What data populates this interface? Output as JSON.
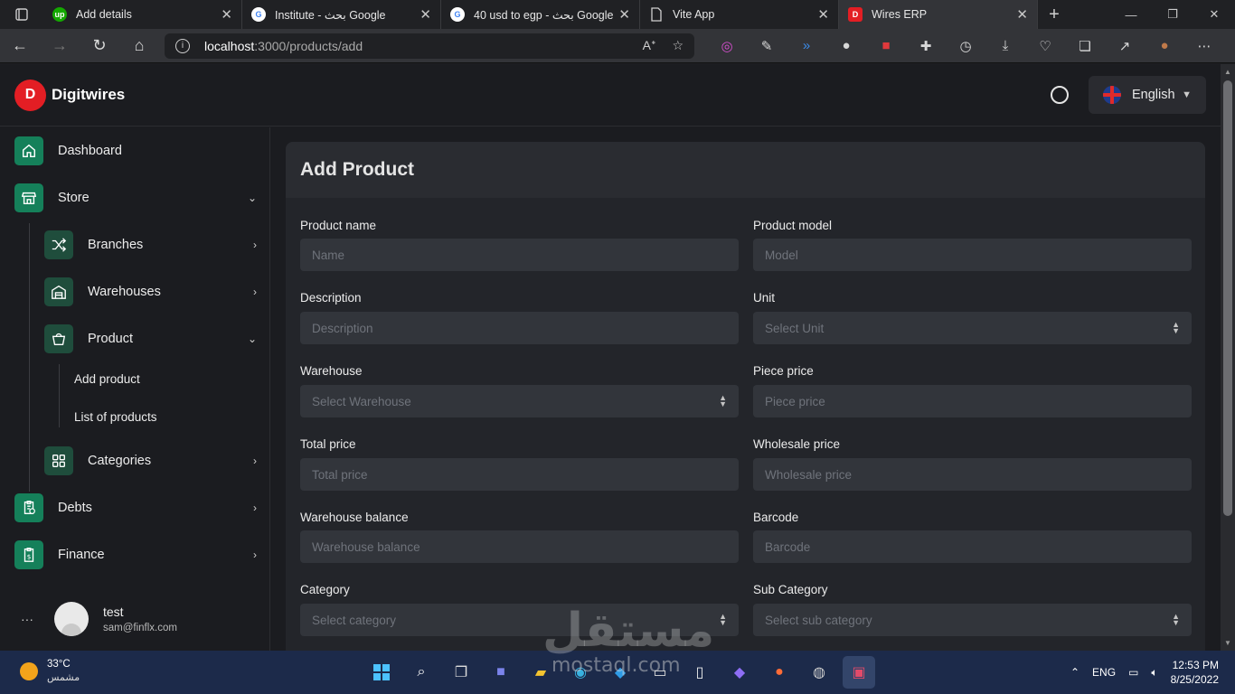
{
  "browser": {
    "tabs": [
      {
        "title": "Add details",
        "fav": "up",
        "fav_color": "#14a800"
      },
      {
        "title": "Institute - بحث Google",
        "fav": "G",
        "fav_color": "#ffffff"
      },
      {
        "title": "40 usd to egp - بحث Google",
        "fav": "G",
        "fav_color": "#ffffff"
      },
      {
        "title": "Vite App",
        "fav": "doc",
        "fav_color": "#cfcfcf"
      },
      {
        "title": "Wires ERP",
        "fav": "D",
        "fav_color": "#e31e24"
      }
    ],
    "url_host": "localhost",
    "url_path": ":3000/products/add"
  },
  "app": {
    "brand": "Digitwires",
    "language": "English"
  },
  "sidebar": {
    "dashboard": "Dashboard",
    "store": "Store",
    "branches": "Branches",
    "warehouses": "Warehouses",
    "product": "Product",
    "add_product": "Add product",
    "list_products": "List of products",
    "categories": "Categories",
    "debts": "Debts",
    "finance": "Finance",
    "user_name": "test",
    "user_email": "sam@finflx.com"
  },
  "form": {
    "title": "Add Product",
    "product_name": {
      "label": "Product name",
      "placeholder": "Name"
    },
    "product_model": {
      "label": "Product model",
      "placeholder": "Model"
    },
    "description": {
      "label": "Description",
      "placeholder": "Description"
    },
    "unit": {
      "label": "Unit",
      "placeholder": "Select Unit"
    },
    "warehouse": {
      "label": "Warehouse",
      "placeholder": "Select Warehouse"
    },
    "piece_price": {
      "label": "Piece price",
      "placeholder": "Piece price"
    },
    "total_price": {
      "label": "Total price",
      "placeholder": "Total price"
    },
    "wholesale_price": {
      "label": "Wholesale price",
      "placeholder": "Wholesale price"
    },
    "warehouse_balance": {
      "label": "Warehouse balance",
      "placeholder": "Warehouse balance"
    },
    "barcode": {
      "label": "Barcode",
      "placeholder": "Barcode"
    },
    "category": {
      "label": "Category",
      "placeholder": "Select category"
    },
    "sub_category": {
      "label": "Sub Category",
      "placeholder": "Select sub category"
    }
  },
  "taskbar": {
    "temp": "33°C",
    "condition": "مشمس",
    "lang": "ENG",
    "time": "12:53 PM",
    "date": "8/25/2022"
  },
  "watermark": {
    "arabic": "مستقل",
    "latin": "mostaql.com"
  }
}
